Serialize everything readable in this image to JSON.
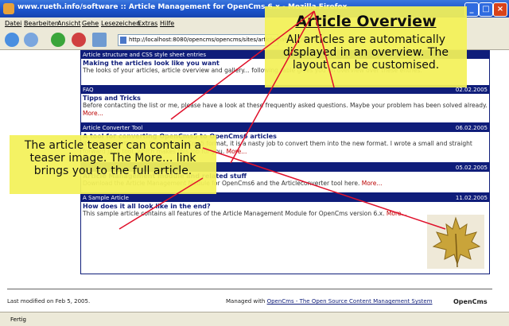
{
  "window": {
    "title": "www.rueth.info/software :: Article Management for OpenCms 6.x - Mozilla Firefox"
  },
  "menu": [
    "Datei",
    "Bearbeiten",
    "Ansicht",
    "Gehe",
    "Lesezeichen",
    "Extras",
    "Hilfe"
  ],
  "address": {
    "url": "http://localhost:8080/opencms/opencms/sites/articlemanager/index.html"
  },
  "articles": [
    {
      "title": "Article structure and CSS style sheet entries",
      "date": "",
      "teaser": "Making the articles look like you want",
      "text": "The looks of your articles, article overview and gallery... following table gives you an overview over these entries.",
      "more": "More..."
    },
    {
      "title": "FAQ",
      "date": "02.02.2005",
      "teaser": "Tipps and Tricks",
      "text": "Before contacting the list or me, please have a look at these frequently asked questions. Maybe your problem has been solved already.",
      "more": "More..."
    },
    {
      "title": "Article Converter Tool",
      "date": "06.02.2005",
      "teaser": "A tool for converting OpenCms5 to OpenCms6 articles",
      "text": "If you have articles in the old OpenCms5 format, it is a nasty job to convert them into the new format. I wrote a small and straight forward Java tool, which makes this job for you.",
      "more": "More..."
    },
    {
      "title": "",
      "date": "05.02.2005",
      "teaser": "Article Management module and related stuff",
      "text": "Download the Article Management Module for OpenCms6 and the Articleconverter tool here.",
      "more": "More..."
    },
    {
      "title": "A Sample Article",
      "date": "11.02.2005",
      "teaser": "How does it all look like in the end?",
      "text": "This sample article contains all features of the Article Management Module for OpenCms version 6.x.",
      "more": "More..."
    }
  ],
  "footer": {
    "modified": "Last modified on Feb 5, 2005.",
    "managed_prefix": "Managed with",
    "managed_link": "OpenCms - The Open Source Content Management System",
    "logo": "OpenCms"
  },
  "status": "Fertig",
  "callouts": {
    "top_title": "Article Overview",
    "top_text": "All articles are automatically displayed in an overview. The layout can be customised.",
    "left_text": "The article teaser can contain a teaser image. The More... link brings you to the full article."
  },
  "colors": {
    "header_blue": "#0f1d7a",
    "callout_yellow": "#f4f259",
    "more_red": "#bb0000",
    "pointer_red": "#e0102a"
  }
}
